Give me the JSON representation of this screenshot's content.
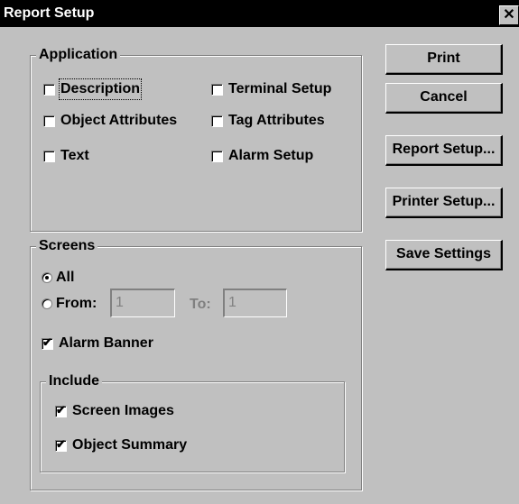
{
  "window": {
    "title": "Report Setup",
    "close_glyph": "✕"
  },
  "application": {
    "legend": "Application",
    "description": "Description",
    "object_attributes": "Object Attributes",
    "text": "Text",
    "terminal_setup": "Terminal Setup",
    "tag_attributes": "Tag Attributes",
    "alarm_setup": "Alarm Setup"
  },
  "screens": {
    "legend": "Screens",
    "all_label": "All",
    "from_label": "From:",
    "from_value": "1",
    "to_label": "To:",
    "to_value": "1",
    "alarm_banner": "Alarm Banner",
    "include": {
      "legend": "Include",
      "screen_images": "Screen Images",
      "object_summary": "Object Summary"
    }
  },
  "buttons": {
    "print": "Print",
    "cancel": "Cancel",
    "report_setup": "Report Setup...",
    "printer_setup": "Printer Setup...",
    "save_settings": "Save Settings"
  },
  "colors": {
    "dialog_bg": "#c0c0c0",
    "titlebar_bg": "#000000",
    "titlebar_text": "#ffffff"
  }
}
